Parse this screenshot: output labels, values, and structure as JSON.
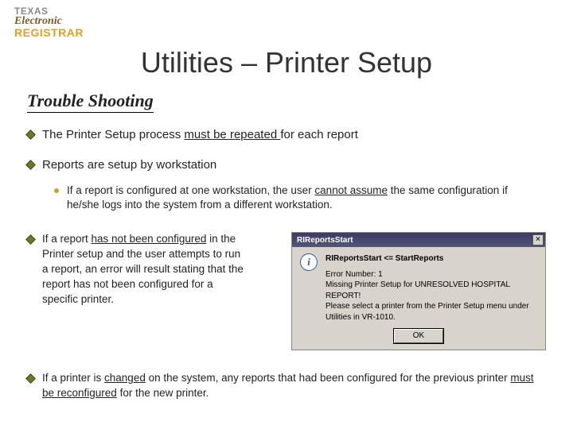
{
  "logo": {
    "line1": "TEXAS",
    "line2a": "Electronic",
    "line2b": "REGISTRAR"
  },
  "title": "Utilities – Printer Setup",
  "subtitle": "Trouble Shooting",
  "bullets": {
    "b1_pre": "The Printer Setup process ",
    "b1_u": "must be repeated ",
    "b1_post": "for each report",
    "b2": "Reports are setup by workstation",
    "sub_pre": "If a report is configured at one workstation, the user ",
    "sub_u": "cannot assume",
    "sub_post": " the same configuration if he/she logs into the system from a different workstation.",
    "b3_pre": "If a report ",
    "b3_u": "has not been configured",
    "b3_post": " in the Printer setup and the user attempts to run a report, an error will result stating that the report has not been configured for a specific printer.",
    "b4_pre": "If a printer is ",
    "b4_u1": "changed",
    "b4_mid": " on the system, any reports that had been configured for the previous printer ",
    "b4_u2": "must be reconfigured",
    "b4_post": " for the new printer."
  },
  "dialog": {
    "title": "RIReportsStart",
    "close": "×",
    "icon_glyph": "i",
    "heading": "RIReportsStart <= StartReports",
    "line1": "Error Number: 1",
    "line2": "Missing Printer Setup for UNRESOLVED HOSPITAL REPORT!",
    "line3": "Please select a printer from the Printer Setup menu under Utilities in VR-1010.",
    "ok": "OK"
  }
}
